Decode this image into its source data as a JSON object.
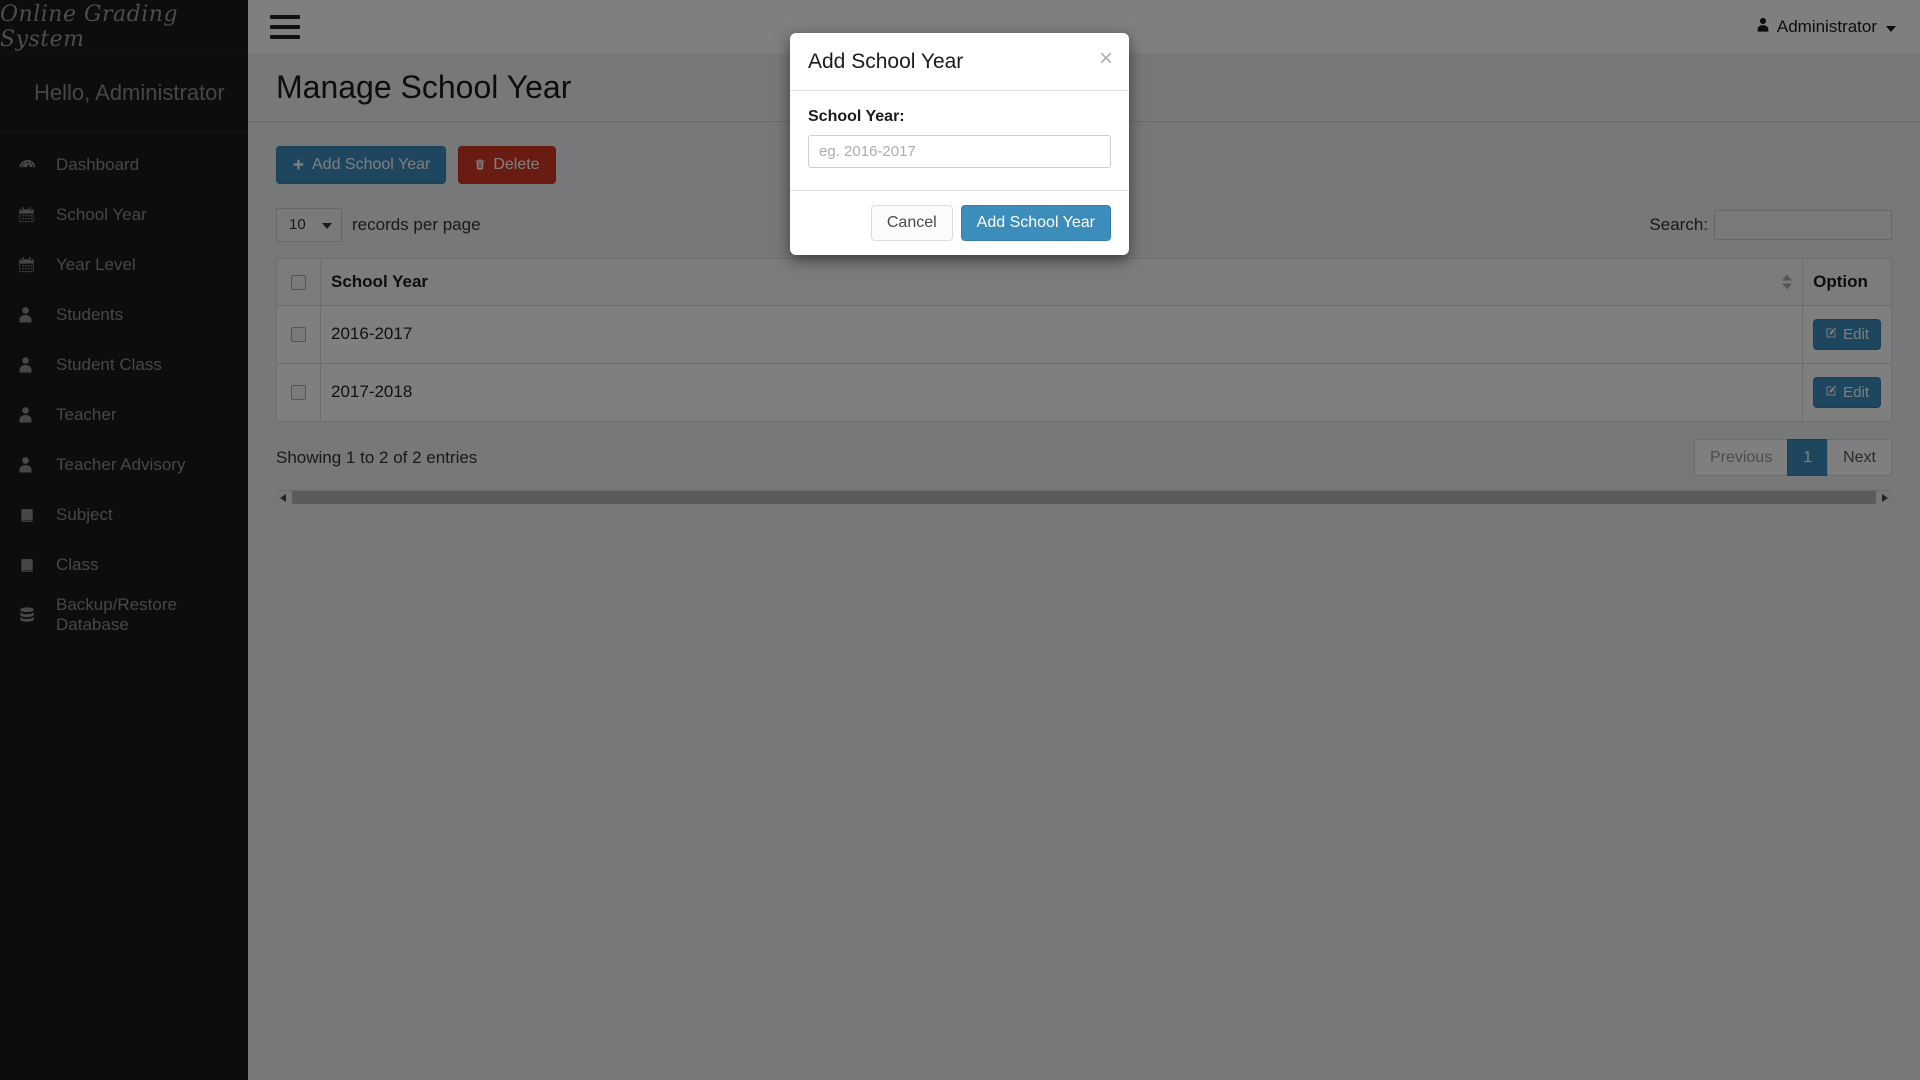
{
  "brand": {
    "title": "Online Grading System"
  },
  "sidebar": {
    "greeting": "Hello, Administrator",
    "items": [
      {
        "label": "Dashboard",
        "icon": "dashboard-icon"
      },
      {
        "label": "School Year",
        "icon": "calendar-icon"
      },
      {
        "label": "Year Level",
        "icon": "calendar-icon"
      },
      {
        "label": "Students",
        "icon": "user-icon"
      },
      {
        "label": "Student Class",
        "icon": "user-icon"
      },
      {
        "label": "Teacher",
        "icon": "user-icon"
      },
      {
        "label": "Teacher Advisory",
        "icon": "user-icon"
      },
      {
        "label": "Subject",
        "icon": "book-icon"
      },
      {
        "label": "Class",
        "icon": "book-icon"
      },
      {
        "label": "Backup/Restore Database",
        "icon": "database-icon"
      }
    ]
  },
  "navbar": {
    "menu_toggle": "hamburger-icon",
    "user": "Administrator"
  },
  "page": {
    "title": "Manage School Year"
  },
  "toolbar": {
    "add_label": "Add School Year",
    "delete_label": "Delete"
  },
  "table_controls": {
    "length_value": "10",
    "length_label": "records per page",
    "search_label": "Search:",
    "search_value": "",
    "search_placeholder": ""
  },
  "table": {
    "columns": [
      "",
      "School Year",
      "Option"
    ],
    "rows": [
      {
        "school_year": "2016-2017",
        "option": "Edit"
      },
      {
        "school_year": "2017-2018",
        "option": "Edit"
      }
    ]
  },
  "table_footer": {
    "info": "Showing 1 to 2 of 2 entries",
    "pagination": {
      "previous": "Previous",
      "pages": [
        "1"
      ],
      "next": "Next",
      "active_page": "1"
    }
  },
  "modal": {
    "title": "Add School Year",
    "close": "×",
    "field_label": "School Year:",
    "input_value": "",
    "input_placeholder": "eg. 2016-2017",
    "cancel_label": "Cancel",
    "confirm_label": "Add School Year"
  },
  "colors": {
    "primary": "#3c8dbc",
    "danger": "#d73925",
    "sidebar_bg": "#1a1a1a",
    "content_bg": "#ecf0f5"
  }
}
